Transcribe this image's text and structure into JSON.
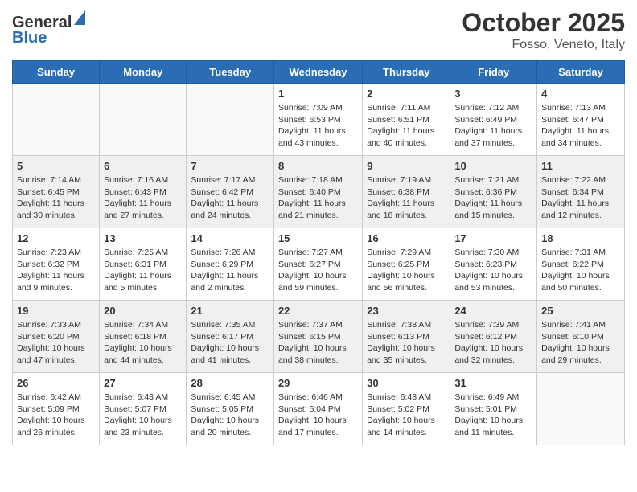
{
  "logo": {
    "general": "General",
    "blue": "Blue"
  },
  "title": "October 2025",
  "subtitle": "Fosso, Veneto, Italy",
  "days_of_week": [
    "Sunday",
    "Monday",
    "Tuesday",
    "Wednesday",
    "Thursday",
    "Friday",
    "Saturday"
  ],
  "weeks": [
    [
      {
        "day": "",
        "info": ""
      },
      {
        "day": "",
        "info": ""
      },
      {
        "day": "",
        "info": ""
      },
      {
        "day": "1",
        "info": "Sunrise: 7:09 AM\nSunset: 6:53 PM\nDaylight: 11 hours\nand 43 minutes."
      },
      {
        "day": "2",
        "info": "Sunrise: 7:11 AM\nSunset: 6:51 PM\nDaylight: 11 hours\nand 40 minutes."
      },
      {
        "day": "3",
        "info": "Sunrise: 7:12 AM\nSunset: 6:49 PM\nDaylight: 11 hours\nand 37 minutes."
      },
      {
        "day": "4",
        "info": "Sunrise: 7:13 AM\nSunset: 6:47 PM\nDaylight: 11 hours\nand 34 minutes."
      }
    ],
    [
      {
        "day": "5",
        "info": "Sunrise: 7:14 AM\nSunset: 6:45 PM\nDaylight: 11 hours\nand 30 minutes."
      },
      {
        "day": "6",
        "info": "Sunrise: 7:16 AM\nSunset: 6:43 PM\nDaylight: 11 hours\nand 27 minutes."
      },
      {
        "day": "7",
        "info": "Sunrise: 7:17 AM\nSunset: 6:42 PM\nDaylight: 11 hours\nand 24 minutes."
      },
      {
        "day": "8",
        "info": "Sunrise: 7:18 AM\nSunset: 6:40 PM\nDaylight: 11 hours\nand 21 minutes."
      },
      {
        "day": "9",
        "info": "Sunrise: 7:19 AM\nSunset: 6:38 PM\nDaylight: 11 hours\nand 18 minutes."
      },
      {
        "day": "10",
        "info": "Sunrise: 7:21 AM\nSunset: 6:36 PM\nDaylight: 11 hours\nand 15 minutes."
      },
      {
        "day": "11",
        "info": "Sunrise: 7:22 AM\nSunset: 6:34 PM\nDaylight: 11 hours\nand 12 minutes."
      }
    ],
    [
      {
        "day": "12",
        "info": "Sunrise: 7:23 AM\nSunset: 6:32 PM\nDaylight: 11 hours\nand 9 minutes."
      },
      {
        "day": "13",
        "info": "Sunrise: 7:25 AM\nSunset: 6:31 PM\nDaylight: 11 hours\nand 5 minutes."
      },
      {
        "day": "14",
        "info": "Sunrise: 7:26 AM\nSunset: 6:29 PM\nDaylight: 11 hours\nand 2 minutes."
      },
      {
        "day": "15",
        "info": "Sunrise: 7:27 AM\nSunset: 6:27 PM\nDaylight: 10 hours\nand 59 minutes."
      },
      {
        "day": "16",
        "info": "Sunrise: 7:29 AM\nSunset: 6:25 PM\nDaylight: 10 hours\nand 56 minutes."
      },
      {
        "day": "17",
        "info": "Sunrise: 7:30 AM\nSunset: 6:23 PM\nDaylight: 10 hours\nand 53 minutes."
      },
      {
        "day": "18",
        "info": "Sunrise: 7:31 AM\nSunset: 6:22 PM\nDaylight: 10 hours\nand 50 minutes."
      }
    ],
    [
      {
        "day": "19",
        "info": "Sunrise: 7:33 AM\nSunset: 6:20 PM\nDaylight: 10 hours\nand 47 minutes."
      },
      {
        "day": "20",
        "info": "Sunrise: 7:34 AM\nSunset: 6:18 PM\nDaylight: 10 hours\nand 44 minutes."
      },
      {
        "day": "21",
        "info": "Sunrise: 7:35 AM\nSunset: 6:17 PM\nDaylight: 10 hours\nand 41 minutes."
      },
      {
        "day": "22",
        "info": "Sunrise: 7:37 AM\nSunset: 6:15 PM\nDaylight: 10 hours\nand 38 minutes."
      },
      {
        "day": "23",
        "info": "Sunrise: 7:38 AM\nSunset: 6:13 PM\nDaylight: 10 hours\nand 35 minutes."
      },
      {
        "day": "24",
        "info": "Sunrise: 7:39 AM\nSunset: 6:12 PM\nDaylight: 10 hours\nand 32 minutes."
      },
      {
        "day": "25",
        "info": "Sunrise: 7:41 AM\nSunset: 6:10 PM\nDaylight: 10 hours\nand 29 minutes."
      }
    ],
    [
      {
        "day": "26",
        "info": "Sunrise: 6:42 AM\nSunset: 5:09 PM\nDaylight: 10 hours\nand 26 minutes."
      },
      {
        "day": "27",
        "info": "Sunrise: 6:43 AM\nSunset: 5:07 PM\nDaylight: 10 hours\nand 23 minutes."
      },
      {
        "day": "28",
        "info": "Sunrise: 6:45 AM\nSunset: 5:05 PM\nDaylight: 10 hours\nand 20 minutes."
      },
      {
        "day": "29",
        "info": "Sunrise: 6:46 AM\nSunset: 5:04 PM\nDaylight: 10 hours\nand 17 minutes."
      },
      {
        "day": "30",
        "info": "Sunrise: 6:48 AM\nSunset: 5:02 PM\nDaylight: 10 hours\nand 14 minutes."
      },
      {
        "day": "31",
        "info": "Sunrise: 6:49 AM\nSunset: 5:01 PM\nDaylight: 10 hours\nand 11 minutes."
      },
      {
        "day": "",
        "info": ""
      }
    ]
  ]
}
